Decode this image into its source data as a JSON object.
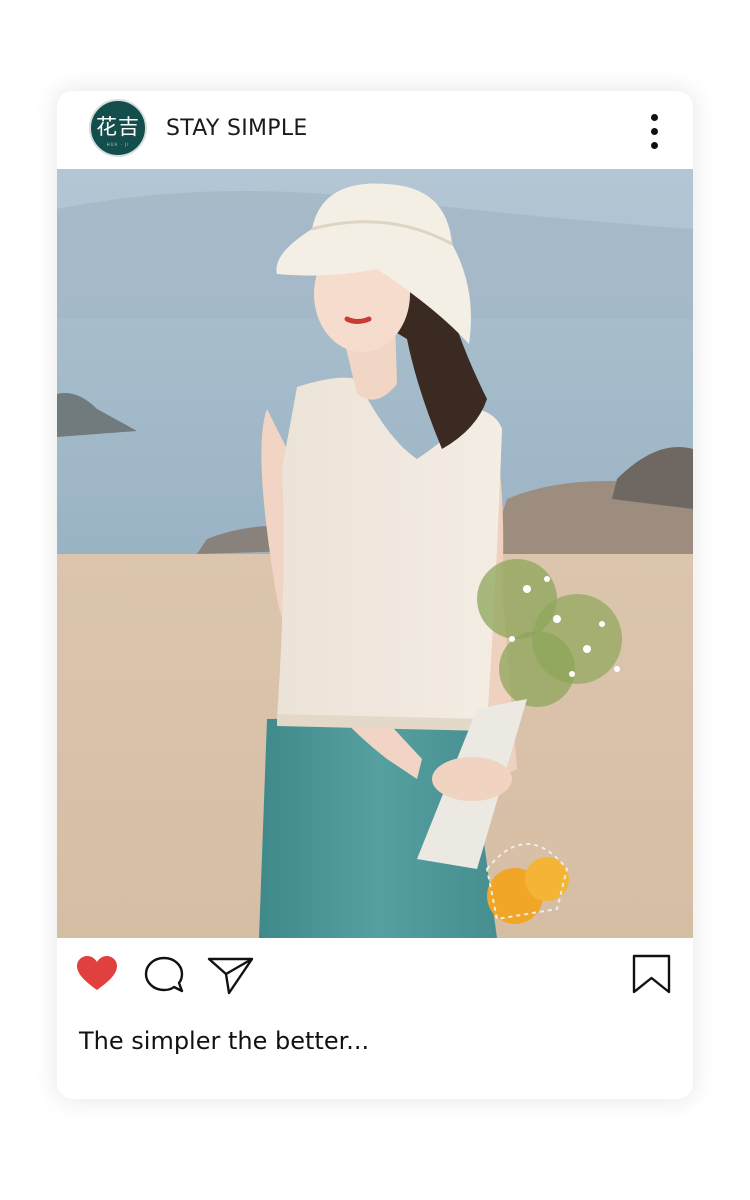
{
  "post": {
    "avatar_text": "花吉",
    "avatar_small": "HUA · JI",
    "account_name": "STAY SIMPLE",
    "caption": "The simpler the better..."
  },
  "photo": {
    "description_icon": "beach-portrait-photo"
  },
  "actions": {
    "like_icon": "heart-icon",
    "comment_icon": "comment-icon",
    "share_icon": "send-icon",
    "save_icon": "bookmark-icon",
    "liked": true
  },
  "colors": {
    "like": "#e0413f",
    "avatar_bg": "#134d4c",
    "skirt": "#4f9698",
    "sand": "#dcc3a9",
    "sea": "#9fb8c8"
  }
}
